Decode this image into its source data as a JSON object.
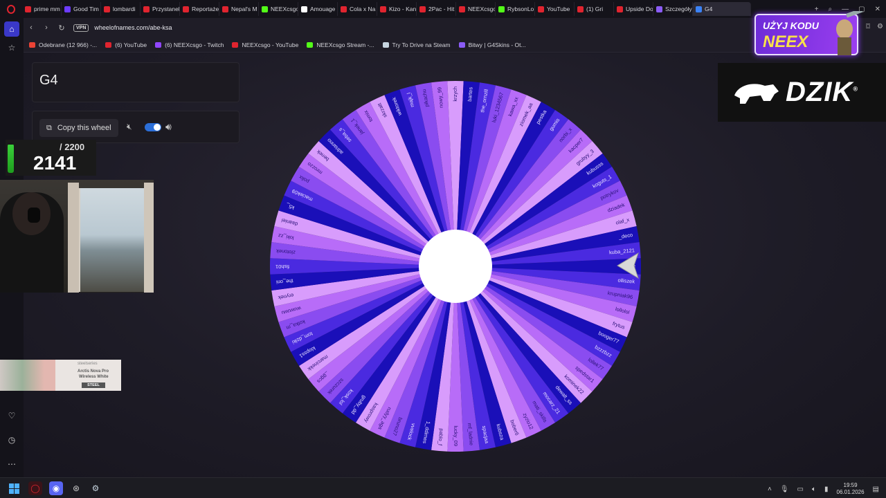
{
  "browser": {
    "tabs": [
      {
        "label": "prime mm",
        "color": "#e0242f"
      },
      {
        "label": "Good Tim",
        "color": "#6d3cff"
      },
      {
        "label": "lombardi",
        "color": "#e0242f"
      },
      {
        "label": "Przystanek",
        "color": "#e0242f"
      },
      {
        "label": "Reportaże",
        "color": "#e0242f"
      },
      {
        "label": "Nepal's M",
        "color": "#e0242f"
      },
      {
        "label": "NEEXcsgo",
        "color": "#53fc18"
      },
      {
        "label": "Amouage",
        "color": "#ffffff"
      },
      {
        "label": "Cola x Na",
        "color": "#e0242f"
      },
      {
        "label": "Kizo - Kan",
        "color": "#e0242f"
      },
      {
        "label": "2Pac - Hit",
        "color": "#e0242f"
      },
      {
        "label": "NEEXcsgo",
        "color": "#e0242f"
      },
      {
        "label": "RybsonLo",
        "color": "#53fc18"
      },
      {
        "label": "YouTube",
        "color": "#e0242f"
      },
      {
        "label": "(1) Gri",
        "color": "#e0242f"
      },
      {
        "label": "Upside Do",
        "color": "#e0242f"
      },
      {
        "label": "Szczegóły",
        "color": "#8b5cf6"
      },
      {
        "label": "G4",
        "color": "#3b82f6",
        "active": true
      }
    ],
    "address": {
      "vpn_label": "VPN",
      "url": "wheelofnames.com/abe-ksa"
    },
    "bookmarks": [
      {
        "label": "Odebrane (12 966) -...",
        "color": "#ea4335"
      },
      {
        "label": "(6) YouTube",
        "color": "#e0242f"
      },
      {
        "label": "(6) NEEXcsgo - Twitch",
        "color": "#9146ff"
      },
      {
        "label": "NEEXcsgo - YouTube",
        "color": "#e0242f"
      },
      {
        "label": "NEEXcsgo Stream -...",
        "color": "#53fc18"
      },
      {
        "label": "Try To Drive na Steam",
        "color": "#c7d5e0"
      },
      {
        "label": "Bitwy | G4Skins - Ot...",
        "color": "#8b5cf6"
      }
    ]
  },
  "wheel_page": {
    "title": "G4",
    "copy_button_label": "Copy this wheel",
    "sound_enabled": true,
    "colors": [
      "#1a0fb8",
      "#4a2ae0",
      "#8a4cf0",
      "#b86cf8",
      "#d89cfc"
    ],
    "entries": [
      "fumee",
      "olliszek",
      "krupniak96",
      "lollolol",
      "frytus",
      "booger77",
      "bzzzbzz",
      "lollek77",
      "spedstar1",
      "kominek22",
      "dewalt_ss",
      "mocarz_21",
      "mati_skills",
      "zyzio12",
      "bober6",
      "kubsza",
      "spacjaa",
      "mf_ladnie",
      "lucky_09",
      "pablo_f",
      "1_ddimes",
      "vvelock",
      "bruno27",
      "rudyy_aga",
      "kasprowy",
      "gruby_dd",
      "kosk_lol",
      "szczurek",
      "_ggcs",
      "marcinekk",
      "klopss1",
      "tom_dziki",
      "kotka_m",
      "wuwuwu",
      "erynek",
      "the_oni",
      "fish01",
      "zlotonek",
      "loki_zz",
      "daaniel",
      "k5_",
      "maciek09",
      "polix",
      "mrozzo",
      "benek",
      "adrianno",
      "seba_s",
      "janek_1",
      "tomix",
      "skrzatt",
      "wiktorek",
      "majk_l",
      "pikachu",
      "nowy_99",
      "krzych",
      "bartes",
      "the_ornzill",
      "luki_1234567",
      "kawa_xx",
      "ziomek_aa",
      "pestka",
      "gumis",
      "norbi_x",
      "kacper7",
      "grubyy_3",
      "kubusss",
      "koguts_1",
      "potrykov",
      "dziadek",
      "olaf_x",
      "_deco",
      "kuba_2121"
    ]
  },
  "overlays": {
    "counter_goal": "/ 2200",
    "counter_value": "2141",
    "counter_progress": 0.973,
    "promo_top": "UŻYJ KODU",
    "promo_code": "NEEX",
    "dzik_logo": "DZIK",
    "dzik_mark": "®",
    "steel_brand": "steelseries",
    "steel_line1": "Arctis Nova Pro",
    "steel_line2": "Wireless White",
    "steel_code": "STEEL"
  },
  "taskbar": {
    "time": "19:59",
    "date": "06.01.2026"
  }
}
